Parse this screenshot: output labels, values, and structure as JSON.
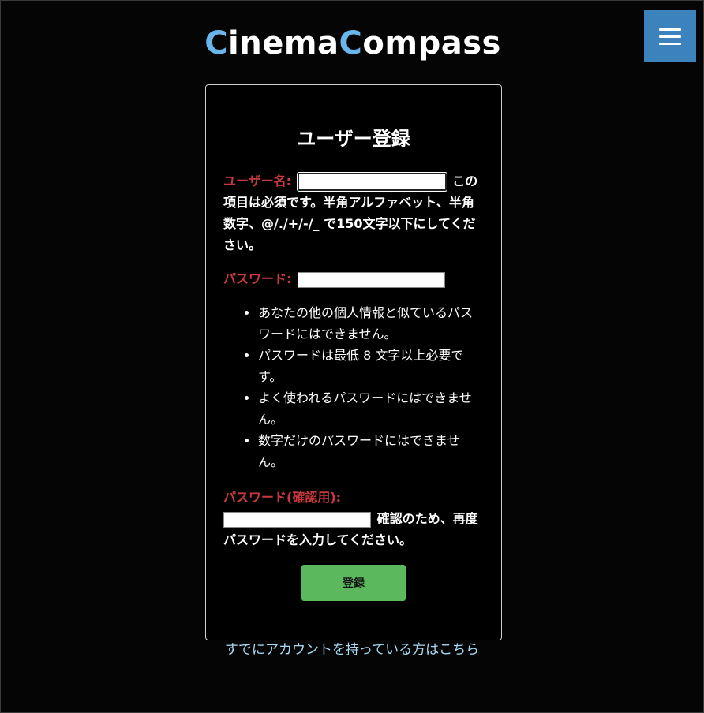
{
  "header": {
    "logo_parts": [
      "C",
      "inema",
      "C",
      "ompass"
    ],
    "menu_icon": "hamburger-menu-icon"
  },
  "colors": {
    "accent": "#6ab6ec",
    "menu_button": "#3c83be",
    "label": "#c9393d",
    "submit_button": "#5cb85c",
    "link": "#a9d9f2"
  },
  "form": {
    "title": "ユーザー登録",
    "username": {
      "label": "ユーザー名:",
      "value": "",
      "help": "この項目は必須です。半角アルファベット、半角数字、@/./+/-/_ で150文字以下にしてください。"
    },
    "password": {
      "label": "パスワード:",
      "value": "",
      "help_items": [
        "あなたの他の個人情報と似ているパスワードにはできません。",
        "パスワードは最低 8 文字以上必要です。",
        "よく使われるパスワードにはできません。",
        "数字だけのパスワードにはできません。"
      ]
    },
    "password_confirm": {
      "label": "パスワード(確認用):",
      "value": "",
      "help": "確認のため、再度パスワードを入力してください。"
    },
    "submit_label": "登録"
  },
  "footer": {
    "login_link": "すでにアカウントを持っている方はこちら"
  }
}
